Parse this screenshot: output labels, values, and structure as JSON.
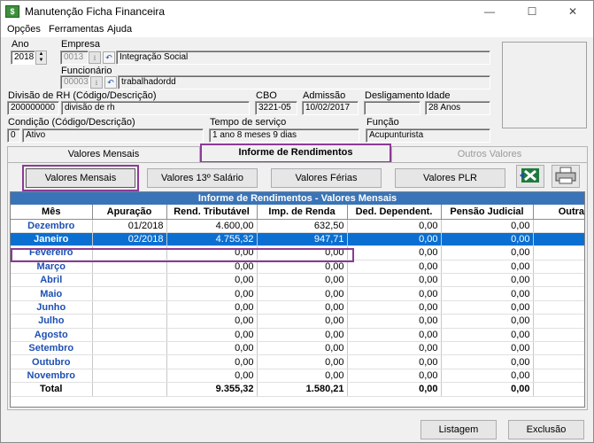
{
  "window": {
    "title": "Manutenção Ficha Financeira",
    "icon_text": "$",
    "controls": [
      "—",
      "☐",
      "✕"
    ]
  },
  "menu": [
    "Opções",
    "Ferramentas",
    "Ajuda"
  ],
  "form": {
    "ano_label": "Ano",
    "ano_value": "2018",
    "empresa_label": "Empresa",
    "empresa_code": "0013",
    "empresa_name": "Integração Social",
    "funcionario_label": "Funcionário",
    "funcionario_code": "00003",
    "funcionario_name": "trabalhadordd",
    "divisao_label": "Divisão de RH (Código/Descrição)",
    "divisao_code": "200000000",
    "divisao_name": "divisão de rh",
    "cbo_label": "CBO",
    "cbo_value": "3221-05",
    "admissao_label": "Admissão",
    "admissao_value": "10/02/2017",
    "desligamento_label": "Desligamento",
    "desligamento_value": "",
    "idade_label": "Idade",
    "idade_value": "28 Anos",
    "condicao_label": "Condição (Código/Descrição)",
    "condicao_code": "0",
    "condicao_name": "Ativo",
    "tempo_label": "Tempo de serviço",
    "tempo_value": "1 ano 8 meses 9 dias",
    "funcao_label": "Função",
    "funcao_value": "Acupunturista"
  },
  "tabs": [
    "Valores Mensais",
    "Informe de Rendimentos",
    "Outros Valores"
  ],
  "buttons": {
    "mensais": "Valores Mensais",
    "salario13": "Valores 13º Salário",
    "ferias": "Valores Férias",
    "plr": "Valores PLR",
    "listagem": "Listagem",
    "exclusao": "Exclusão"
  },
  "grid": {
    "title": "Informe de Rendimentos - Valores Mensais",
    "columns": [
      "Mês",
      "Apuração",
      "Rend. Tributável",
      "Imp. de Renda",
      "Ded. Dependent.",
      "Pensão Judicial",
      "Outras De"
    ],
    "rows": [
      [
        "Dezembro",
        "01/2018",
        "4.600,00",
        "632,50",
        "0,00",
        "0,00",
        ""
      ],
      [
        "Janeiro",
        "02/2018",
        "4.755,32",
        "947,71",
        "0,00",
        "0,00",
        ""
      ],
      [
        "Fevereiro",
        "",
        "0,00",
        "0,00",
        "0,00",
        "0,00",
        ""
      ],
      [
        "Março",
        "",
        "0,00",
        "0,00",
        "0,00",
        "0,00",
        ""
      ],
      [
        "Abril",
        "",
        "0,00",
        "0,00",
        "0,00",
        "0,00",
        ""
      ],
      [
        "Maio",
        "",
        "0,00",
        "0,00",
        "0,00",
        "0,00",
        ""
      ],
      [
        "Junho",
        "",
        "0,00",
        "0,00",
        "0,00",
        "0,00",
        ""
      ],
      [
        "Julho",
        "",
        "0,00",
        "0,00",
        "0,00",
        "0,00",
        ""
      ],
      [
        "Agosto",
        "",
        "0,00",
        "0,00",
        "0,00",
        "0,00",
        ""
      ],
      [
        "Setembro",
        "",
        "0,00",
        "0,00",
        "0,00",
        "0,00",
        ""
      ],
      [
        "Outubro",
        "",
        "0,00",
        "0,00",
        "0,00",
        "0,00",
        ""
      ],
      [
        "Novembro",
        "",
        "0,00",
        "0,00",
        "0,00",
        "0,00",
        ""
      ]
    ],
    "total": [
      "Total",
      "",
      "9.355,32",
      "1.580,21",
      "0,00",
      "0,00",
      ""
    ],
    "selected_row": 1
  },
  "colors": {
    "selection": "#0a6fd1",
    "highlight": "#8b3b95",
    "header_blue": "#3a74b8",
    "month_text": "#1d4fb3"
  }
}
